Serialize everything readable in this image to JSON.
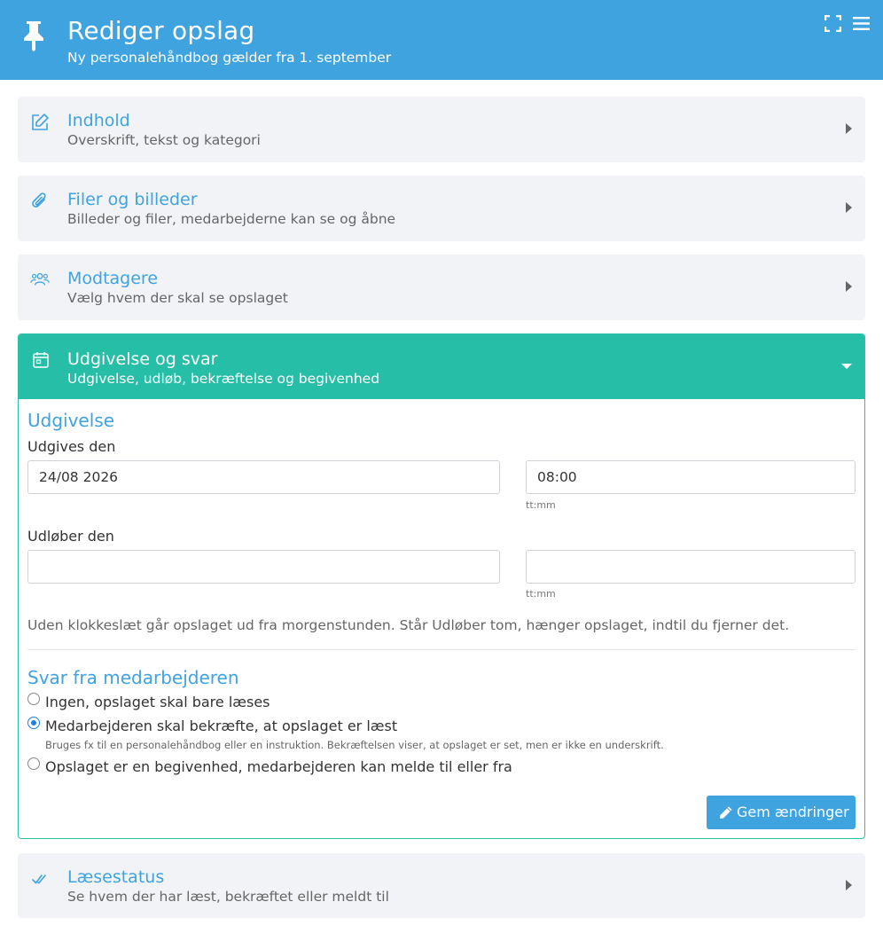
{
  "header": {
    "title": "Rediger opslag",
    "subtitle": "Ny personalehåndbog gælder fra 1. september",
    "icons": [
      "pushpin-icon",
      "expand-icon",
      "menu-icon"
    ]
  },
  "sections": {
    "content": {
      "title": "Indhold",
      "subtitle": "Overskrift, tekst og kategori",
      "icon": "pencil-square-icon"
    },
    "files": {
      "title": "Filer og billeder",
      "subtitle": "Billeder og filer, medarbejderne kan se og åbne",
      "icon": "paperclip-icon"
    },
    "recipients": {
      "title": "Modtagere",
      "subtitle": "Vælg hvem der skal se opslaget",
      "icon": "users-icon"
    },
    "publish": {
      "title": "Udgivelse og svar",
      "subtitle": "Udgivelse, udløb, bekræftelse og begivenhed",
      "icon": "calendar-icon"
    },
    "readstatus": {
      "title": "Læsestatus",
      "subtitle": "Se hvem der har læst, bekræftet eller meldt til",
      "icon": "double-check-icon"
    }
  },
  "publish_form": {
    "heading": "Udgivelse",
    "publish_label": "Udgives den",
    "publish_date": "24/08 2026",
    "publish_time": "08:00",
    "time_hint": "tt:mm",
    "expire_label": "Udløber den",
    "expire_date": "",
    "expire_time": "",
    "expire_time_hint": "tt:mm",
    "note": "Uden klokkeslæt går opslaget ud fra morgenstunden. Står Udløber tom, hænger opslaget, indtil du fjerner det."
  },
  "response": {
    "heading": "Svar fra medarbejderen",
    "options": [
      {
        "label": "Ingen, opslaget skal bare læses",
        "checked": false
      },
      {
        "label": "Medarbejderen skal bekræfte, at opslaget er læst",
        "checked": true,
        "help": "Bruges fx til en personalehåndbog eller en instruktion. Bekræftelsen viser, at opslaget er set, men er ikke en underskrift."
      },
      {
        "label": "Opslaget er en begivenhed, medarbejderen kan melde til eller fra",
        "checked": false
      }
    ]
  },
  "actions": {
    "save_label": "Gem ændringer"
  },
  "colors": {
    "primary": "#3fa3e0",
    "accent": "#27bea7",
    "section_bg": "#f2f3f6"
  }
}
